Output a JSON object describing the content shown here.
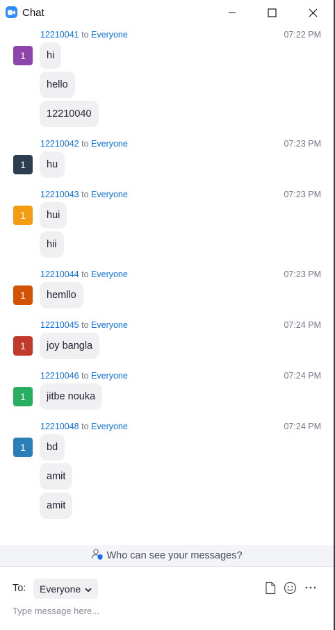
{
  "window": {
    "title": "Chat",
    "icon": "zoom-camera-icon",
    "controls": [
      "minimize-icon",
      "maximize-icon",
      "close-icon"
    ]
  },
  "messages": [
    {
      "sender": "12210041",
      "to_word": "to",
      "recipient": "Everyone",
      "time": "07:22 PM",
      "avatar_letter": "1",
      "avatar_color": "#8E44AD",
      "texts": [
        "hi",
        "hello",
        "12210040"
      ]
    },
    {
      "sender": "12210042",
      "to_word": "to",
      "recipient": "Everyone",
      "time": "07:23 PM",
      "avatar_letter": "1",
      "avatar_color": "#2C3E50",
      "texts": [
        "hu"
      ]
    },
    {
      "sender": "12210043",
      "to_word": "to",
      "recipient": "Everyone",
      "time": "07:23 PM",
      "avatar_letter": "1",
      "avatar_color": "#F39C12",
      "texts": [
        "hui",
        "hii"
      ]
    },
    {
      "sender": "12210044",
      "to_word": "to",
      "recipient": "Everyone",
      "time": "07:23 PM",
      "avatar_letter": "1",
      "avatar_color": "#D35400",
      "texts": [
        "hemllo"
      ]
    },
    {
      "sender": "12210045",
      "to_word": "to",
      "recipient": "Everyone",
      "time": "07:24 PM",
      "avatar_letter": "1",
      "avatar_color": "#C0392B",
      "texts": [
        "joy bangla"
      ]
    },
    {
      "sender": "12210046",
      "to_word": "to",
      "recipient": "Everyone",
      "time": "07:24 PM",
      "avatar_letter": "1",
      "avatar_color": "#27AE60",
      "texts": [
        "jitbe nouka"
      ]
    },
    {
      "sender": "12210048",
      "to_word": "to",
      "recipient": "Everyone",
      "time": "07:24 PM",
      "avatar_letter": "1",
      "avatar_color": "#2980B9",
      "texts": [
        "bd",
        "amit",
        "amit"
      ]
    }
  ],
  "privacy": {
    "icon": "person-shield-icon",
    "text": "Who can see your messages?"
  },
  "compose": {
    "to_label": "To:",
    "recipient": "Everyone",
    "recipient_icon": "chevron-down-icon",
    "placeholder": "Type message here...",
    "tools": [
      "file-icon",
      "emoji-icon",
      "more-icon"
    ]
  },
  "colors": {
    "accent": "#0E71EB",
    "bubble": "#F0F0F3"
  }
}
